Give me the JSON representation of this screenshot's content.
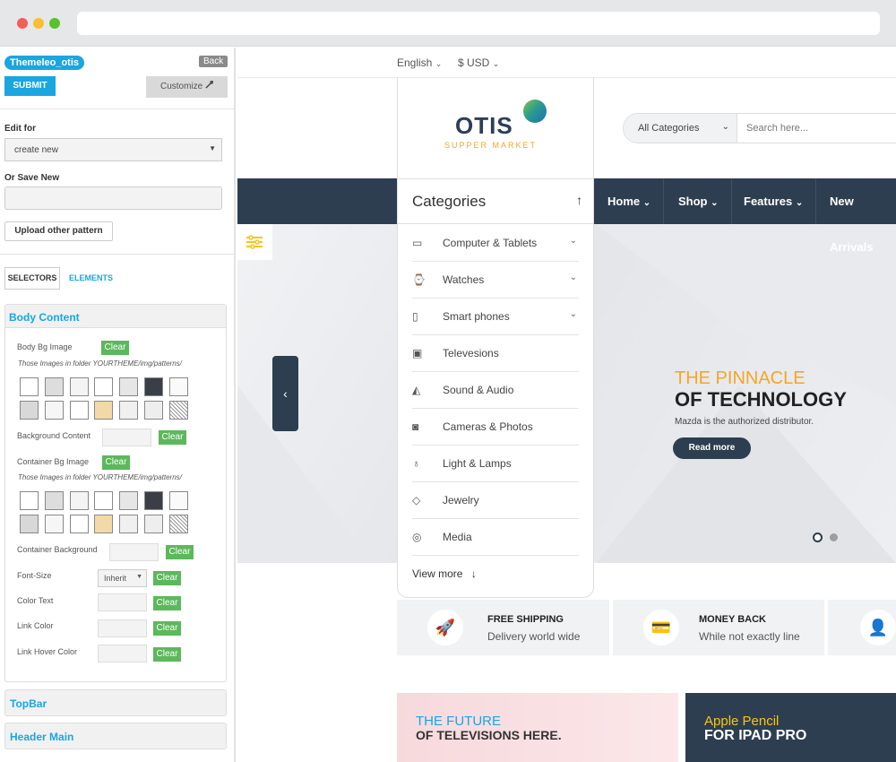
{
  "panel": {
    "theme_name": "Themeleo_otis",
    "back_label": "Back",
    "submit_label": "SUBMIT",
    "customize_label": "Customize",
    "edit_for_label": "Edit for",
    "edit_for_value": "create new",
    "save_new_label": "Or Save New",
    "upload_label": "Upload other pattern",
    "tab_selectors": "SELECTORS",
    "tab_elements": "ELEMENTS",
    "section_title": "Body Content",
    "body_bg_label": "Body Bg Image",
    "clear_label": "Clear",
    "patterns_note": "Those Images in folder YOURTHEME/img/patterns/",
    "bg_content_label": "Background Content",
    "container_bg_image_label": "Container Bg Image",
    "container_background_label": "Container Background",
    "font_size_label": "Font-Size",
    "font_size_value": "Inherit",
    "color_text_label": "Color Text",
    "link_color_label": "Link Color",
    "link_hover_label": "Link Hover Color",
    "topbar_label": "TopBar",
    "header_main_label": "Header Main"
  },
  "site": {
    "language": "English",
    "currency": "$ USD",
    "logo_name": "OTIS",
    "logo_tagline": "SUPPER MARKET",
    "search_category": "All Categories",
    "search_placeholder": "Search here...",
    "categories_title": "Categories",
    "nav": [
      "Home",
      "Shop",
      "Features",
      "New Arrivals"
    ],
    "categories": [
      {
        "label": "Computer & Tablets",
        "icon": "monitor-icon"
      },
      {
        "label": "Watches",
        "icon": "watch-icon"
      },
      {
        "label": "Smart phones",
        "icon": "phone-icon"
      },
      {
        "label": "Televesions",
        "icon": "tv-icon"
      },
      {
        "label": "Sound & Audio",
        "icon": "speaker-icon"
      },
      {
        "label": "Cameras & Photos",
        "icon": "camera-icon"
      },
      {
        "label": "Light & Lamps",
        "icon": "bulb-icon"
      },
      {
        "label": "Jewelry",
        "icon": "diamond-icon"
      },
      {
        "label": "Media",
        "icon": "disc-icon"
      }
    ],
    "view_more": "View more",
    "hero": {
      "line1": "THE PINNACLE",
      "line2": "OF TECHNOLOGY",
      "desc": "Mazda is the authorized distributor.",
      "cta": "Read more"
    },
    "features": [
      {
        "title": "FREE SHIPPING",
        "sub": "Delivery world wide"
      },
      {
        "title": "MONEY BACK",
        "sub": "While not exactly line"
      }
    ],
    "banners": [
      {
        "line1": "THE FUTURE",
        "line2": "OF TELEVISIONS HERE."
      },
      {
        "line1": "Apple Pencil",
        "line2": "FOR IPAD PRO"
      }
    ]
  },
  "colors": {
    "accent_blue": "#1aa6e0",
    "navy": "#2d3e50",
    "orange": "#f5a623",
    "green": "#5cb85c"
  }
}
